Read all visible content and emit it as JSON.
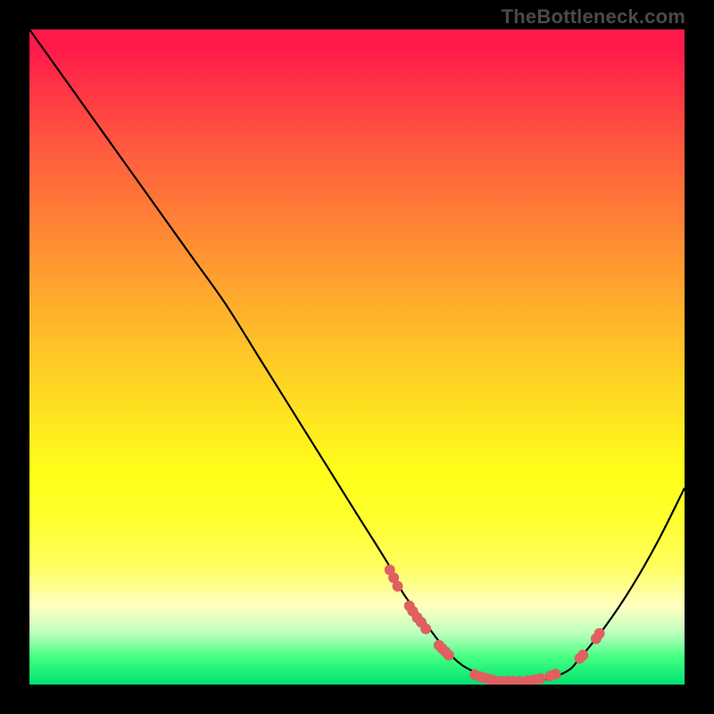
{
  "watermark": "TheBottleneck.com",
  "chart_data": {
    "type": "line",
    "title": "",
    "xlabel": "",
    "ylabel": "",
    "xlim": [
      0,
      100
    ],
    "ylim": [
      0,
      100
    ],
    "curve": {
      "x": [
        0,
        5,
        10,
        15,
        20,
        25,
        30,
        35,
        40,
        45,
        50,
        55,
        57,
        60,
        63,
        66,
        70,
        72,
        74,
        78,
        82,
        84,
        88,
        92,
        96,
        100
      ],
      "y": [
        100,
        93,
        86,
        79,
        72,
        65,
        58,
        50,
        42,
        34,
        26,
        18,
        14,
        10,
        6,
        3,
        1,
        0.5,
        0.5,
        0.6,
        2,
        4,
        9,
        15,
        22,
        30
      ]
    },
    "points": [
      {
        "x": 55.0,
        "y": 17.5
      },
      {
        "x": 55.6,
        "y": 16.3
      },
      {
        "x": 56.2,
        "y": 15.0
      },
      {
        "x": 58.0,
        "y": 12.0
      },
      {
        "x": 58.5,
        "y": 11.2
      },
      {
        "x": 59.2,
        "y": 10.2
      },
      {
        "x": 59.8,
        "y": 9.5
      },
      {
        "x": 60.5,
        "y": 8.5
      },
      {
        "x": 62.5,
        "y": 6.0
      },
      {
        "x": 63.0,
        "y": 5.5
      },
      {
        "x": 63.5,
        "y": 5.0
      },
      {
        "x": 64.0,
        "y": 4.5
      },
      {
        "x": 68.0,
        "y": 1.5
      },
      {
        "x": 68.8,
        "y": 1.2
      },
      {
        "x": 69.5,
        "y": 1.0
      },
      {
        "x": 70.3,
        "y": 0.8
      },
      {
        "x": 71.0,
        "y": 0.6
      },
      {
        "x": 72.0,
        "y": 0.5
      },
      {
        "x": 73.0,
        "y": 0.5
      },
      {
        "x": 73.8,
        "y": 0.5
      },
      {
        "x": 74.8,
        "y": 0.5
      },
      {
        "x": 76.0,
        "y": 0.6
      },
      {
        "x": 77.0,
        "y": 0.7
      },
      {
        "x": 78.0,
        "y": 0.9
      },
      {
        "x": 79.5,
        "y": 1.3
      },
      {
        "x": 80.3,
        "y": 1.6
      },
      {
        "x": 84.0,
        "y": 4.0
      },
      {
        "x": 84.5,
        "y": 4.5
      },
      {
        "x": 86.5,
        "y": 7.0
      },
      {
        "x": 87.0,
        "y": 7.8
      }
    ],
    "point_radius": 6,
    "gradient_stops": [
      {
        "pos": 0,
        "color": "#ff1a4a"
      },
      {
        "pos": 68,
        "color": "#ffff1a"
      },
      {
        "pos": 96,
        "color": "#40ff80"
      },
      {
        "pos": 100,
        "color": "#00e070"
      }
    ]
  }
}
